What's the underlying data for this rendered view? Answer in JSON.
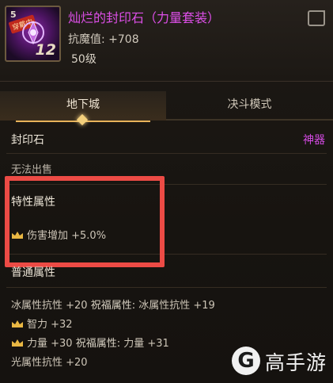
{
  "item": {
    "icon_level": "5",
    "icon_badge": "穿戴中",
    "icon_number": "12",
    "name": "灿烂的封印石（力量套装）",
    "stat": "抗魔值: +708",
    "level": "50级"
  },
  "tabs": [
    {
      "label": "地下城",
      "active": true
    },
    {
      "label": "决斗模式",
      "active": false
    }
  ],
  "info": {
    "type": "封印石",
    "rarity": "神器",
    "trade": "无法出售"
  },
  "special": {
    "title": "特性属性",
    "attrs": [
      "伤害增加 +5.0%"
    ]
  },
  "normal": {
    "title": "普通属性",
    "line1_a": "冰属性抗性 +20",
    "line1_b": "祝福属性:",
    "line1_c": "冰属性抗性 +19",
    "line2": "智力 +32",
    "line3_a": "力量 +30",
    "line3_b": "祝福属性:",
    "line3_c": "力量 +31",
    "line4": "光属性抗性 +20"
  },
  "watermark": {
    "text": "高手游"
  },
  "colors": {
    "rarity": "#d34ae2",
    "highlight": "#ec4b45",
    "crown": "#e9b743"
  }
}
